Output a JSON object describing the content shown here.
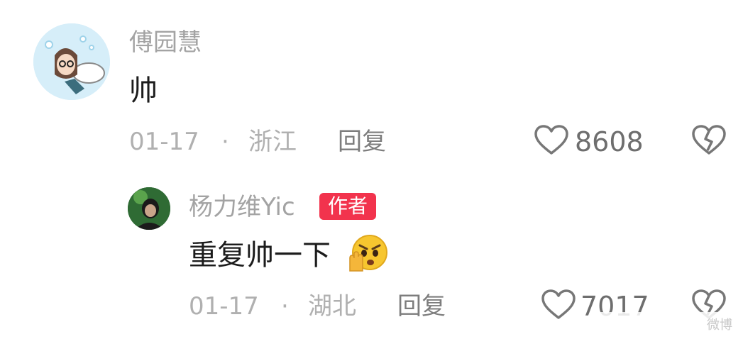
{
  "comment": {
    "author": "傅园慧",
    "text": "帅",
    "date": "01-17",
    "separator": "·",
    "location": "浙江",
    "reply_label": "回复",
    "like_count": "8608"
  },
  "reply": {
    "author": "杨力维Yic",
    "author_badge": "作者",
    "text": "重复帅一下",
    "emoji": "angry-face-with-hand-emoji",
    "date": "01-17",
    "separator": "·",
    "location": "湖北",
    "reply_label": "回复",
    "like_count": "7017"
  },
  "watermark": "微博",
  "colors": {
    "badge": "#f2334d",
    "meta_text": "#b0b0b0",
    "name_text": "#a3a3a3"
  }
}
